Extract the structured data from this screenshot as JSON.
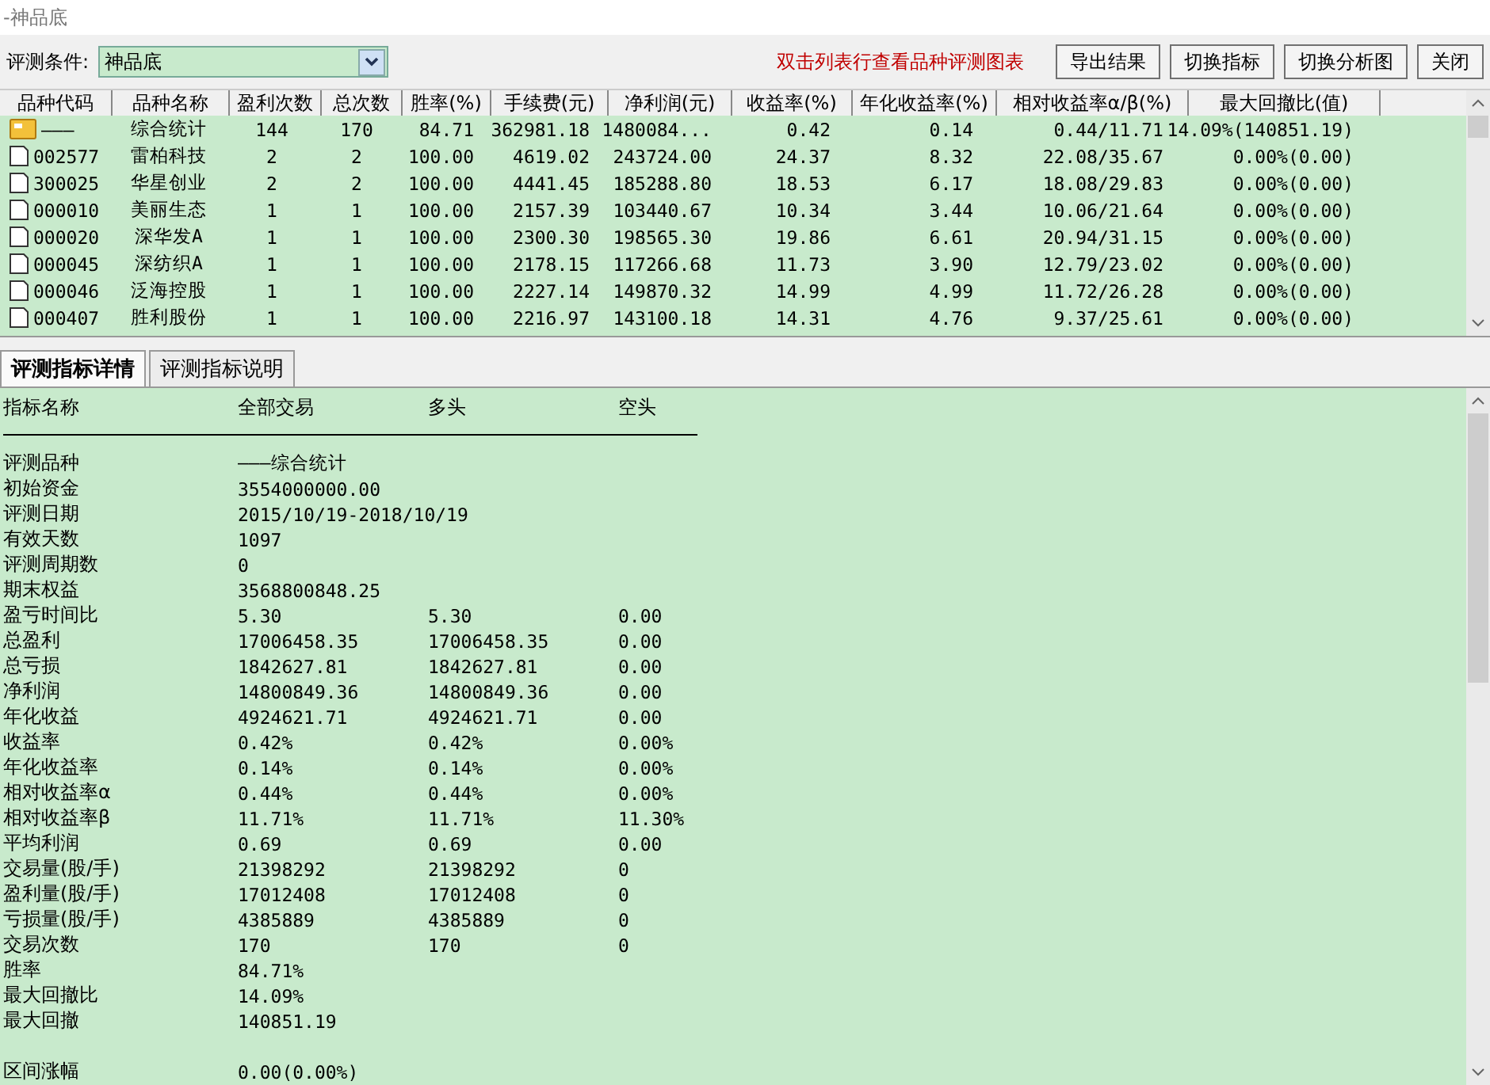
{
  "window": {
    "title": "-神品底"
  },
  "toolbar": {
    "condition_label": "评测条件:",
    "condition_value": "神品底",
    "hint": "双击列表行查看品种评测图表",
    "buttons": [
      "导出结果",
      "切换指标",
      "切换分析图",
      "关闭"
    ]
  },
  "table": {
    "columns": [
      "品种代码",
      "品种名称",
      "盈利次数",
      "总次数",
      "胜率(%)",
      "手续费(元)",
      "净利润(元)",
      "收益率(%)",
      "年化收益率(%)",
      "相对收益率α/β(%)",
      "最大回撤比(值)"
    ],
    "rows": [
      {
        "kind": "summary",
        "cells": [
          "———",
          "综合统计",
          "144",
          "170",
          "84.71",
          "362981.18",
          "1480084...",
          "0.42",
          "0.14",
          "0.44/11.71",
          "14.09%(140851.19)"
        ]
      },
      {
        "kind": "item",
        "cells": [
          "002577",
          "雷柏科技",
          "2",
          "2",
          "100.00",
          "4619.02",
          "243724.00",
          "24.37",
          "8.32",
          "22.08/35.67",
          "0.00%(0.00)"
        ]
      },
      {
        "kind": "item",
        "cells": [
          "300025",
          "华星创业",
          "2",
          "2",
          "100.00",
          "4441.45",
          "185288.80",
          "18.53",
          "6.17",
          "18.08/29.83",
          "0.00%(0.00)"
        ]
      },
      {
        "kind": "item",
        "cells": [
          "000010",
          "美丽生态",
          "1",
          "1",
          "100.00",
          "2157.39",
          "103440.67",
          "10.34",
          "3.44",
          "10.06/21.64",
          "0.00%(0.00)"
        ]
      },
      {
        "kind": "item",
        "cells": [
          "000020",
          "深华发A",
          "1",
          "1",
          "100.00",
          "2300.30",
          "198565.30",
          "19.86",
          "6.61",
          "20.94/31.15",
          "0.00%(0.00)"
        ]
      },
      {
        "kind": "item",
        "cells": [
          "000045",
          "深纺织A",
          "1",
          "1",
          "100.00",
          "2178.15",
          "117266.68",
          "11.73",
          "3.90",
          "12.79/23.02",
          "0.00%(0.00)"
        ]
      },
      {
        "kind": "item",
        "cells": [
          "000046",
          "泛海控股",
          "1",
          "1",
          "100.00",
          "2227.14",
          "149870.32",
          "14.99",
          "4.99",
          "11.72/26.28",
          "0.00%(0.00)"
        ]
      },
      {
        "kind": "item",
        "cells": [
          "000407",
          "胜利股份",
          "1",
          "1",
          "100.00",
          "2216.97",
          "143100.18",
          "14.31",
          "4.76",
          "9.37/25.61",
          "0.00%(0.00)"
        ]
      }
    ]
  },
  "tabs": [
    {
      "label": "评测指标详情",
      "selected": true
    },
    {
      "label": "评测指标说明",
      "selected": false
    }
  ],
  "details": {
    "columns": [
      "指标名称",
      "全部交易",
      "多头",
      "空头"
    ],
    "rows": [
      {
        "cells": [
          "评测品种",
          "———综合统计"
        ]
      },
      {
        "cells": [
          "初始资金",
          "3554000000.00"
        ]
      },
      {
        "cells": [
          "评测日期",
          "2015/10/19-2018/10/19"
        ]
      },
      {
        "cells": [
          "有效天数",
          "1097"
        ]
      },
      {
        "cells": [
          "评测周期数",
          "0"
        ]
      },
      {
        "cells": [
          "期末权益",
          "3568800848.25"
        ]
      },
      {
        "cells": [
          "盈亏时间比",
          "5.30",
          "5.30",
          "0.00"
        ]
      },
      {
        "cells": [
          "总盈利",
          "17006458.35",
          "17006458.35",
          "0.00"
        ]
      },
      {
        "cells": [
          "总亏损",
          "1842627.81",
          "1842627.81",
          "0.00"
        ]
      },
      {
        "cells": [
          "净利润",
          "14800849.36",
          "14800849.36",
          "0.00"
        ]
      },
      {
        "cells": [
          "年化收益",
          "4924621.71",
          "4924621.71",
          "0.00"
        ]
      },
      {
        "cells": [
          "收益率",
          "0.42%",
          "0.42%",
          "0.00%"
        ]
      },
      {
        "cells": [
          "年化收益率",
          "0.14%",
          "0.14%",
          "0.00%"
        ]
      },
      {
        "cells": [
          "相对收益率α",
          "0.44%",
          "0.44%",
          "0.00%"
        ]
      },
      {
        "cells": [
          "相对收益率β",
          "11.71%",
          "11.71%",
          "11.30%"
        ]
      },
      {
        "cells": [
          "平均利润",
          "0.69",
          "0.69",
          "0.00"
        ]
      },
      {
        "cells": [
          "交易量(股/手)",
          "21398292",
          "21398292",
          "0"
        ]
      },
      {
        "cells": [
          "盈利量(股/手)",
          "17012408",
          "17012408",
          "0"
        ]
      },
      {
        "cells": [
          "亏损量(股/手)",
          "4385889",
          "4385889",
          "0"
        ]
      },
      {
        "cells": [
          "交易次数",
          "170",
          "170",
          "0"
        ]
      },
      {
        "cells": [
          "胜率",
          "84.71%"
        ]
      },
      {
        "cells": [
          "最大回撤比",
          "14.09%"
        ]
      },
      {
        "cells": [
          "最大回撤",
          "140851.19"
        ]
      },
      {
        "cells": [
          "区间涨幅",
          "0.00(0.00%)"
        ],
        "gap_before": true
      }
    ]
  }
}
